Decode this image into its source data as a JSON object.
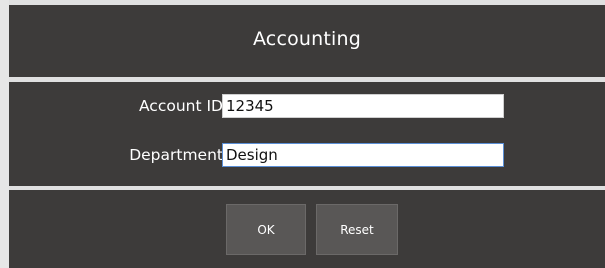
{
  "dialog": {
    "title": "Accounting"
  },
  "form": {
    "account_id": {
      "label": "Account ID",
      "value": "12345"
    },
    "department": {
      "label": "Department",
      "value": "Design"
    }
  },
  "buttons": {
    "ok_label": "OK",
    "reset_label": "Reset"
  },
  "colors": {
    "panel_background": "#3d3b3a",
    "button_background": "#595756",
    "text": "#ffffff"
  }
}
